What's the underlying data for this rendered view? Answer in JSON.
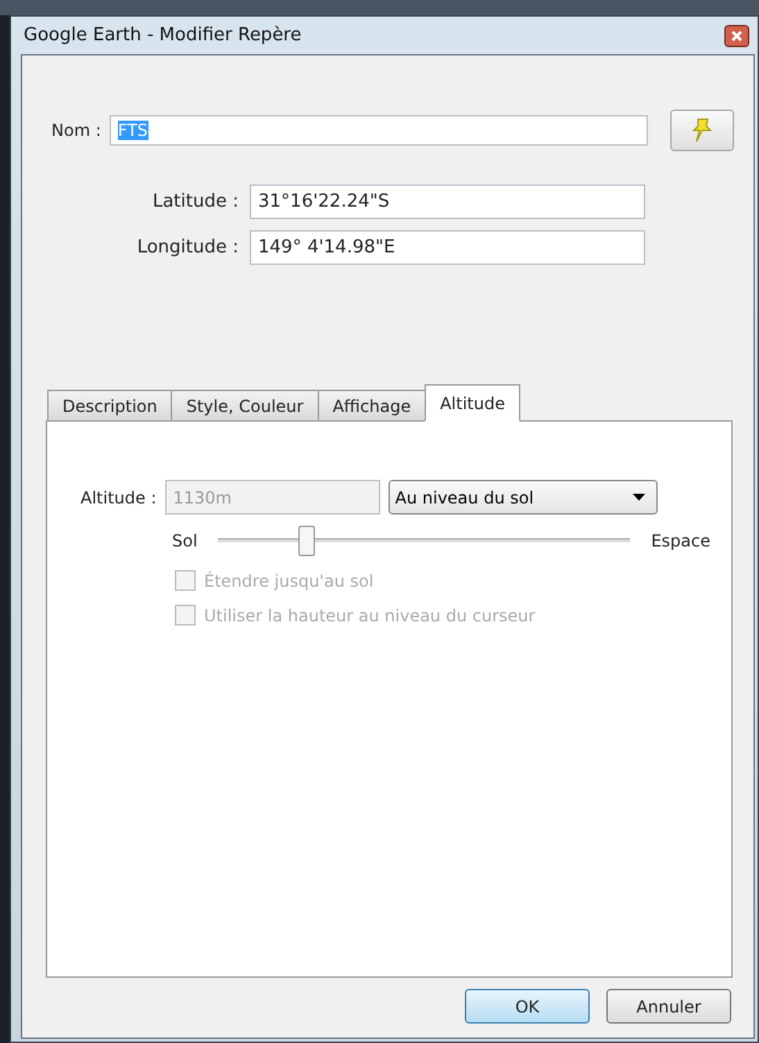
{
  "window": {
    "title": "Google Earth - Modifier Repère"
  },
  "name_field": {
    "label": "Nom :",
    "value": "FTS",
    "selected": true
  },
  "coordinates": [
    {
      "label": "Latitude :",
      "value": "31°16'22.24\"S"
    },
    {
      "label": "Longitude :",
      "value": "149° 4'14.98\"E"
    }
  ],
  "tabs": [
    {
      "label": "Description",
      "selected": false
    },
    {
      "label": "Style, Couleur",
      "selected": false
    },
    {
      "label": "Affichage",
      "selected": false
    },
    {
      "label": "Altitude",
      "selected": true
    }
  ],
  "altitude": {
    "label": "Altitude :",
    "value": "1130m",
    "disabled": true,
    "mode": "Au niveau du sol",
    "slider": {
      "min_label": "Sol",
      "max_label": "Espace",
      "level": 0.21
    },
    "checkboxes": [
      {
        "label": "Étendre jusqu'au sol",
        "checked": false,
        "disabled": true
      },
      {
        "label": "Utiliser la hauteur au niveau du curseur",
        "checked": false,
        "disabled": true
      }
    ]
  },
  "buttons": [
    {
      "label": "OK",
      "kind": "default"
    },
    {
      "label": "Annuler",
      "kind": "normal"
    }
  ]
}
